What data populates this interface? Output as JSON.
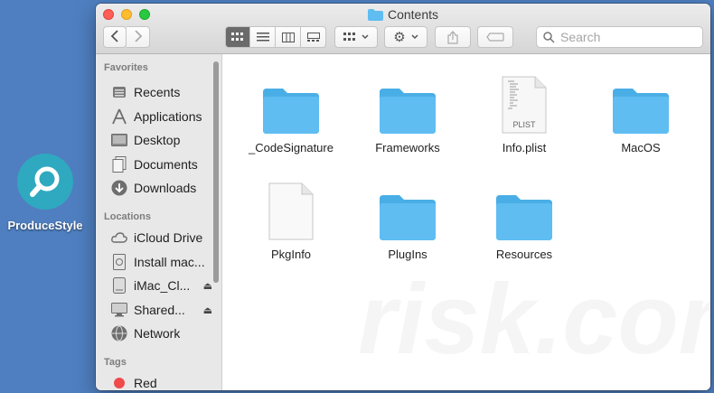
{
  "desktop": {
    "app_label": "ProduceStyle"
  },
  "window": {
    "title": "Contents",
    "search_placeholder": "Search"
  },
  "sidebar": {
    "sections": {
      "favorites": "Favorites",
      "locations": "Locations",
      "tags": "Tags"
    },
    "favorites": [
      {
        "label": "Recents",
        "icon": "recents-icon"
      },
      {
        "label": "Applications",
        "icon": "applications-icon"
      },
      {
        "label": "Desktop",
        "icon": "desktop-icon"
      },
      {
        "label": "Documents",
        "icon": "documents-icon"
      },
      {
        "label": "Downloads",
        "icon": "downloads-icon"
      }
    ],
    "locations": [
      {
        "label": "iCloud Drive",
        "icon": "cloud-icon"
      },
      {
        "label": "Install mac...",
        "icon": "disk-image-icon"
      },
      {
        "label": "iMac_Cl...",
        "icon": "drive-icon",
        "eject": true
      },
      {
        "label": "Shared...",
        "icon": "monitor-icon",
        "eject": true
      },
      {
        "label": "Network",
        "icon": "network-icon"
      }
    ],
    "tags": [
      {
        "label": "Red",
        "color": "#f04a4a"
      }
    ]
  },
  "files": [
    {
      "name": "_CodeSignature",
      "kind": "folder"
    },
    {
      "name": "Frameworks",
      "kind": "folder"
    },
    {
      "name": "Info.plist",
      "kind": "plist",
      "badge": "PLIST"
    },
    {
      "name": "MacOS",
      "kind": "folder"
    },
    {
      "name": "PkgInfo",
      "kind": "document"
    },
    {
      "name": "PlugIns",
      "kind": "folder"
    },
    {
      "name": "Resources",
      "kind": "folder"
    }
  ],
  "colors": {
    "folder": "#5fbdf2",
    "folder_tab": "#4aaee6",
    "desktop_bg": "#4f7fc0"
  }
}
